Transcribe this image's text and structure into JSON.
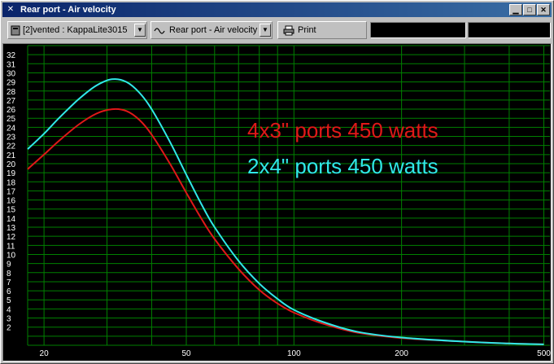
{
  "window": {
    "title": "Rear port - Air velocity",
    "icon": "app-close-x-icon",
    "controls": [
      "minimize",
      "maximize",
      "close"
    ]
  },
  "toolbar": {
    "driver_combo": "[2]vented : KappaLite3015",
    "graph_combo": "Rear port - Air velocity",
    "print_label": "Print"
  },
  "colors": {
    "background": "#000000",
    "grid": "#008000",
    "series_red": "#e01818",
    "series_cyan": "#30e8e8"
  },
  "chart_data": {
    "type": "line",
    "title": "",
    "xlabel": "",
    "ylabel": "",
    "x_scale": "log",
    "xlim": [
      18,
      520
    ],
    "ylim": [
      0,
      33
    ],
    "grid": true,
    "x_tick_labels": [
      "20",
      "50",
      "100",
      "200",
      "500"
    ],
    "y_tick_labels": [
      "2",
      "3",
      "4",
      "5",
      "6",
      "7",
      "8",
      "9",
      "10",
      "11",
      "12",
      "13",
      "14",
      "15",
      "16",
      "17",
      "18",
      "19",
      "20",
      "21",
      "22",
      "23",
      "24",
      "25",
      "26",
      "27",
      "28",
      "29",
      "30",
      "31",
      "32"
    ],
    "annotations": [
      {
        "text": "4x3\" ports 450 watts",
        "color": "#e01818"
      },
      {
        "text": "2x4\" ports 450 watts",
        "color": "#30e8e8"
      }
    ],
    "series": [
      {
        "color": "#e01818",
        "x": [
          18,
          20,
          22,
          25,
          28,
          31,
          34,
          37,
          40,
          45,
          50,
          55,
          60,
          70,
          80,
          90,
          100,
          120,
          150,
          200,
          300,
          400,
          500
        ],
        "y": [
          19.4,
          21.0,
          22.5,
          24.3,
          25.5,
          26.0,
          25.8,
          24.8,
          23.2,
          20.0,
          16.8,
          14.0,
          11.7,
          8.4,
          6.1,
          4.6,
          3.6,
          2.4,
          1.4,
          0.8,
          0.4,
          0.2,
          0.1
        ]
      },
      {
        "color": "#30e8e8",
        "x": [
          18,
          20,
          22,
          25,
          28,
          31,
          34,
          37,
          40,
          45,
          50,
          55,
          60,
          70,
          80,
          90,
          100,
          120,
          150,
          200,
          300,
          400,
          500
        ],
        "y": [
          21.6,
          23.3,
          25.0,
          27.1,
          28.6,
          29.3,
          29.0,
          27.8,
          26.0,
          22.4,
          18.8,
          15.6,
          13.0,
          9.3,
          6.8,
          5.1,
          3.9,
          2.6,
          1.5,
          0.85,
          0.4,
          0.2,
          0.1
        ]
      }
    ]
  }
}
